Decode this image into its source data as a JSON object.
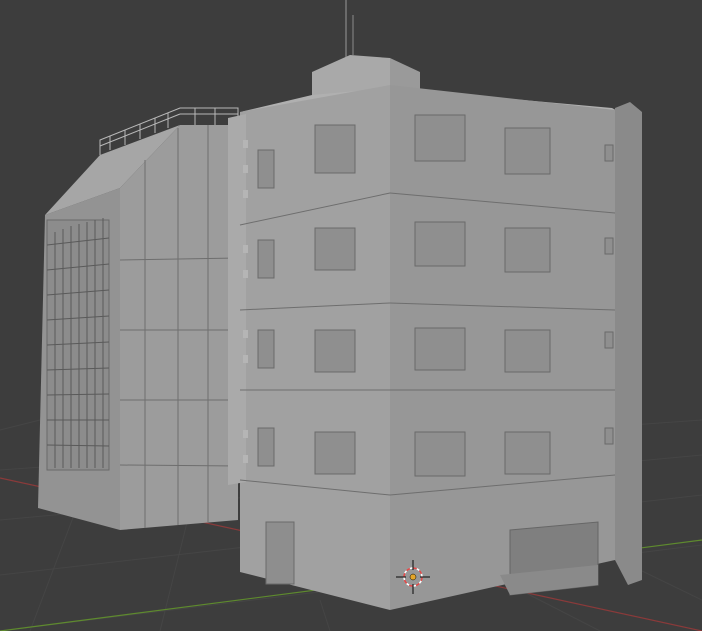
{
  "viewport": {
    "background_color": "#3d3d3d",
    "grid_color": "#454545",
    "x_axis_color": "#8a3a3a",
    "y_axis_color": "#5e8a2e"
  },
  "scene": {
    "objects": [
      "building-left",
      "building-right"
    ],
    "material_color": "#9e9e9e",
    "cursor_icon": "3d-cursor-icon",
    "origin_color": "#e3a52a"
  }
}
